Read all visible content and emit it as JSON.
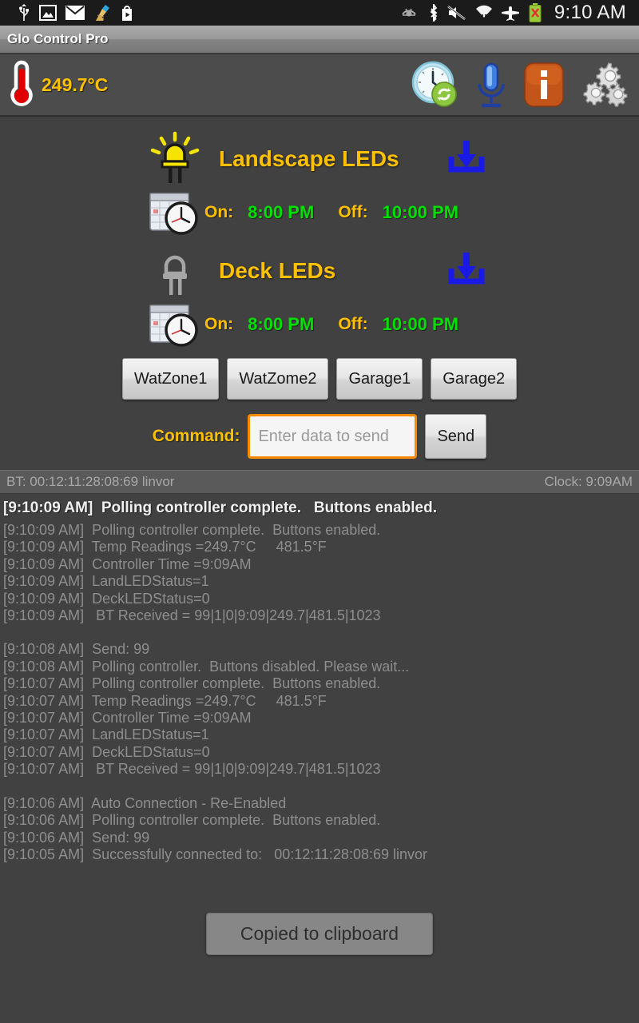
{
  "system_status_bar": {
    "left_icons": [
      "usb-icon",
      "gallery-icon",
      "email-icon",
      "broom-cleaner-icon",
      "play-store-icon"
    ],
    "right_icons": [
      "smart-stay-eye-icon",
      "bluetooth-icon",
      "sound-muted-icon",
      "wifi-icon",
      "airplane-mode-icon",
      "battery-not-charging-icon"
    ],
    "clock": "9:10 AM"
  },
  "titlebar": {
    "app_title": "Glo Control Pro"
  },
  "actionbar": {
    "temperature": "249.7°C",
    "thermometer_icon": "thermometer-icon",
    "icons": [
      {
        "name": "clock-sync-icon",
        "label": "Sync Clock"
      },
      {
        "name": "microphone-icon",
        "label": "Voice Command"
      },
      {
        "name": "info-icon",
        "label": "Info"
      },
      {
        "name": "settings-gears-icon",
        "label": "Settings"
      }
    ]
  },
  "led_sections": [
    {
      "title": "Landscape LEDs",
      "status_icon": "led-on-icon",
      "download_icon": "download-icon",
      "schedule_icon": "calendar-clock-icon",
      "on_label": "On:",
      "on_time": "8:00 PM",
      "off_label": "Off:",
      "off_time": "10:00 PM"
    },
    {
      "title": "Deck LEDs",
      "status_icon": "led-off-icon",
      "download_icon": "download-icon",
      "schedule_icon": "calendar-clock-icon",
      "on_label": "On:",
      "on_time": "8:00 PM",
      "off_label": "Off:",
      "off_time": "10:00 PM"
    }
  ],
  "zone_buttons": [
    {
      "label": "WatZone1"
    },
    {
      "label": "WatZome2"
    },
    {
      "label": "Garage1"
    },
    {
      "label": "Garage2"
    }
  ],
  "command_row": {
    "label": "Command:",
    "input_value": "",
    "input_placeholder": "Enter data to send",
    "send_label": "Send"
  },
  "bt_strip": {
    "device": "BT:  00:12:11:28:08:69 linvor",
    "clock": "Clock:   9:09AM"
  },
  "console": {
    "current_status": "[9:10:09 AM]  Polling controller complete.   Buttons enabled.",
    "lines": [
      "[9:10:09 AM]  Polling controller complete.  Buttons enabled.",
      "[9:10:09 AM]  Temp Readings =249.7°C     481.5°F",
      "[9:10:09 AM]  Controller Time =9:09AM",
      "[9:10:09 AM]  LandLEDStatus=1",
      "[9:10:09 AM]  DeckLEDStatus=0",
      "[9:10:09 AM]   BT Received = 99|1|0|9:09|249.7|481.5|1023",
      "",
      "[9:10:08 AM]  Send: 99",
      "[9:10:08 AM]  Polling controller.  Buttons disabled. Please wait...",
      "[9:10:07 AM]  Polling controller complete.  Buttons enabled.",
      "[9:10:07 AM]  Temp Readings =249.7°C     481.5°F",
      "[9:10:07 AM]  Controller Time =9:09AM",
      "[9:10:07 AM]  LandLEDStatus=1",
      "[9:10:07 AM]  DeckLEDStatus=0",
      "[9:10:07 AM]   BT Received = 99|1|0|9:09|249.7|481.5|1023",
      "",
      "[9:10:06 AM]  Auto Connection - Re-Enabled",
      "[9:10:06 AM]  Polling controller complete.  Buttons enabled.",
      "[9:10:06 AM]  Send: 99",
      "[9:10:05 AM]  Successfully connected to:   00:12:11:28:08:69 linvor"
    ]
  },
  "toast": {
    "message": "Copied to clipboard"
  },
  "colors": {
    "background": "#414141",
    "accent_amber": "#ffc000",
    "time_green": "#00e000",
    "input_border_orange": "#ff8a00",
    "download_blue": "#1a1ae6",
    "info_orange": "#c4551a"
  }
}
